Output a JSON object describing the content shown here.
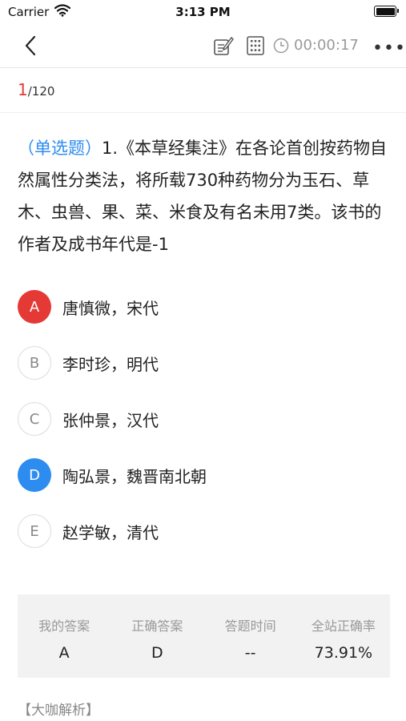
{
  "status_bar": {
    "carrier": "Carrier",
    "time": "3:13 PM"
  },
  "nav": {
    "timer": "00:00:17",
    "more": "•••"
  },
  "progress": {
    "current": "1",
    "total": "/120"
  },
  "question": {
    "type_label": "（单选题）",
    "text": "1.《本草经集注》在各论首创按药物自然属性分类法，将所载730种药物分为玉石、草木、虫兽、果、菜、米食及有名未用7类。该书的作者及成书年代是-1"
  },
  "options": [
    {
      "letter": "A",
      "text": "唐慎微，宋代",
      "state": "selected-wrong",
      "color": "#e53935"
    },
    {
      "letter": "B",
      "text": "李时珍，明代",
      "state": "default"
    },
    {
      "letter": "C",
      "text": "张仲景，汉代",
      "state": "default"
    },
    {
      "letter": "D",
      "text": "陶弘景，魏晋南北朝",
      "state": "correct",
      "color": "#2d8cf0"
    },
    {
      "letter": "E",
      "text": "赵学敏，清代",
      "state": "default"
    }
  ],
  "stats": {
    "my_answer_label": "我的答案",
    "my_answer": "A",
    "correct_label": "正确答案",
    "correct": "D",
    "time_label": "答题时间",
    "time": "--",
    "rate_label": "全站正确率",
    "rate": "73.91%"
  },
  "analysis_label": "【大咖解析】"
}
